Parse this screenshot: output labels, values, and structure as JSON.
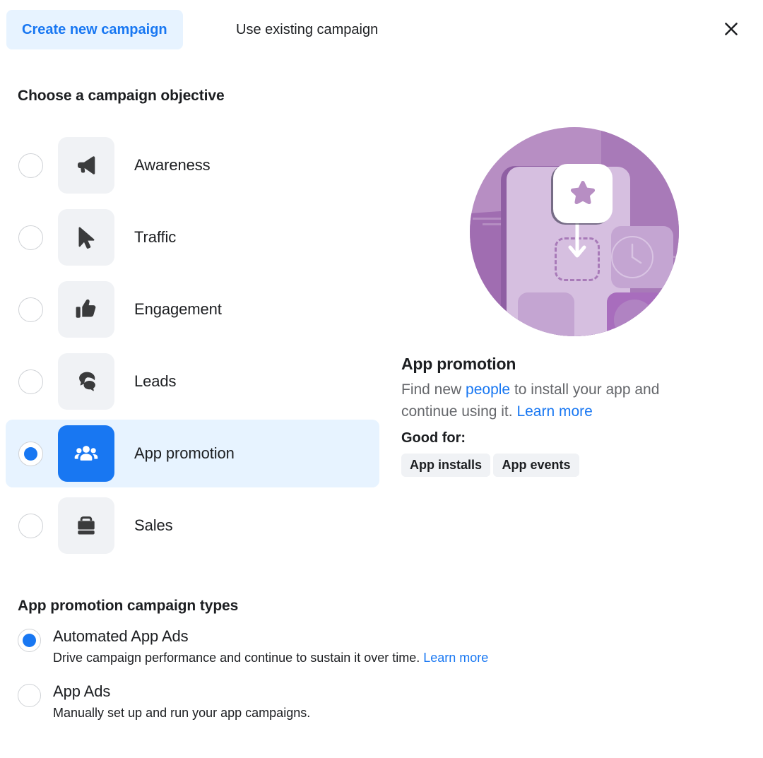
{
  "header": {
    "tabs": [
      {
        "label": "Create new campaign",
        "active": true
      },
      {
        "label": "Use existing campaign",
        "active": false
      }
    ],
    "close_icon": "close-icon"
  },
  "objective_section": {
    "title": "Choose a campaign objective",
    "items": [
      {
        "label": "Awareness",
        "icon": "megaphone-icon",
        "selected": false
      },
      {
        "label": "Traffic",
        "icon": "cursor-icon",
        "selected": false
      },
      {
        "label": "Engagement",
        "icon": "thumbs-up-icon",
        "selected": false
      },
      {
        "label": "Leads",
        "icon": "chat-bubbles-icon",
        "selected": false
      },
      {
        "label": "App promotion",
        "icon": "people-group-icon",
        "selected": true
      },
      {
        "label": "Sales",
        "icon": "briefcase-icon",
        "selected": false
      }
    ]
  },
  "detail": {
    "illustration": "app-promotion-illustration",
    "title": "App promotion",
    "description_part1": "Find new ",
    "description_link1": "people",
    "description_part2": " to install your app and continue using it. ",
    "description_link2": "Learn more",
    "good_for_label": "Good for:",
    "badges": [
      "App installs",
      "App events"
    ]
  },
  "campaign_types_section": {
    "title": "App promotion campaign types",
    "items": [
      {
        "label": "Automated App Ads",
        "description": "Drive campaign performance and continue to sustain it over time. ",
        "link": "Learn more",
        "selected": true
      },
      {
        "label": "App Ads",
        "description": "Manually set up and run your app campaigns.",
        "link": "",
        "selected": false
      }
    ]
  },
  "colors": {
    "accent_blue": "#1877f2",
    "selected_row_bg": "#e7f3ff",
    "tile_bg": "#f0f2f5",
    "text_primary": "#1c1e21",
    "text_secondary": "#65676b",
    "illustration_purple": "#b78ec3"
  }
}
